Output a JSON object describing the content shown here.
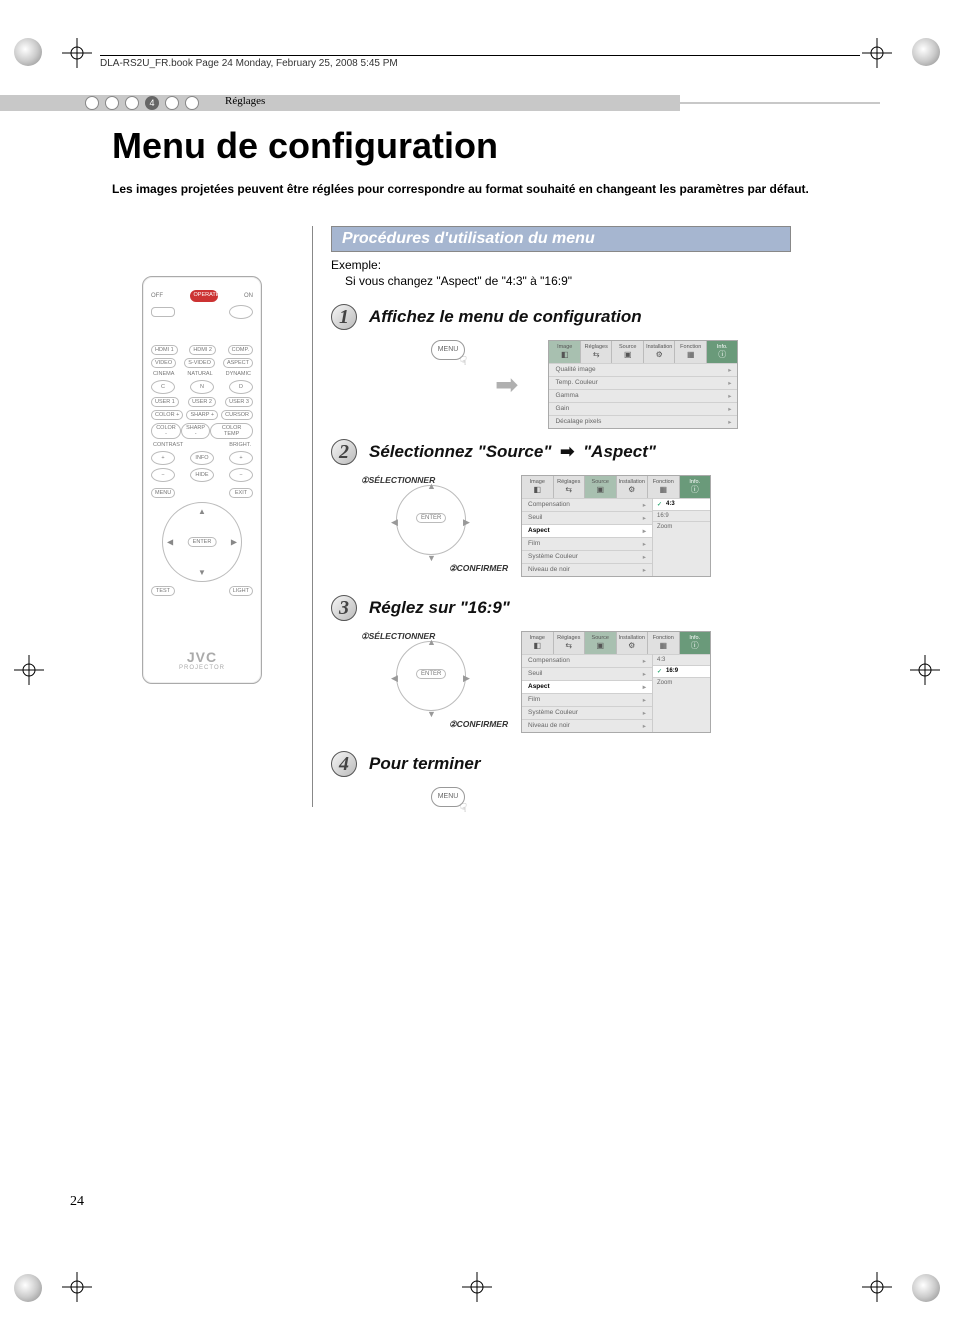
{
  "header_line": "DLA-RS2U_FR.book  Page 24  Monday, February 25, 2008  5:45 PM",
  "ribbon_step_num": "4",
  "ribbon_label": "Réglages",
  "title": "Menu de configuration",
  "intro": "Les images projetées peuvent être réglées pour correspondre au format souhaité en changeant les paramètres par défaut.",
  "section_header": "Procédures d'utilisation du menu",
  "example_heading": "Exemple:",
  "example_text": "Si vous changez \"Aspect\" de \"4:3\" à \"16:9\"",
  "steps": {
    "s1": {
      "num": "1",
      "title": "Affichez le menu de configuration"
    },
    "s2": {
      "num": "2",
      "title_pre": "Sélectionnez \"Source\"",
      "title_post": "\"Aspect\""
    },
    "s3": {
      "num": "3",
      "title": "Réglez sur \"16:9\""
    },
    "s4": {
      "num": "4",
      "title": "Pour terminer"
    }
  },
  "annot": {
    "select_num": "①",
    "select": "SÉLECTIONNER",
    "confirm_num": "②",
    "confirm": "CONFIRMER"
  },
  "btn": {
    "menu": "MENU",
    "enter": "ENTER"
  },
  "osd_tabs": [
    "Image",
    "Réglages",
    "Source",
    "Installation",
    "Fonction",
    "Info."
  ],
  "osd_tab_icons": [
    "◧",
    "⇆",
    "▣",
    "⚙",
    "▦",
    "ⓘ"
  ],
  "osd1_items": [
    "Qualité image",
    "Temp. Couleur",
    "Gamma",
    "Gain",
    "Décalage pixels"
  ],
  "osd2_left": [
    "Compensation",
    "Seuil",
    "Aspect",
    "Film",
    "Système Couleur",
    "Niveau de noir"
  ],
  "osd2_right": [
    "4:3",
    "16:9",
    "Zoom"
  ],
  "osd2_right_sel": 0,
  "osd3_right_sel": 1,
  "remote": {
    "off": "OFF",
    "operate": "OPERATE",
    "on": "ON",
    "row1": [
      "HDMI 1",
      "HDMI 2",
      "COMP."
    ],
    "row2": [
      "VIDEO",
      "S-VIDEO",
      "ASPECT"
    ],
    "row3_lbls": [
      "CINEMA",
      "NATURAL",
      "DYNAMIC"
    ],
    "row3": [
      "C",
      "N",
      "D"
    ],
    "row4": [
      "USER 1",
      "USER 2",
      "USER 3"
    ],
    "row5": [
      "COLOR +",
      "SHARP +",
      "CURSOR"
    ],
    "row6": [
      "COLOR -",
      "SHARP -",
      "COLOR TEMP"
    ],
    "contrast": "CONTRAST",
    "bright": "BRIGHT.",
    "info": "INFO",
    "hide": "HIDE",
    "menu": "MENU",
    "exit": "EXIT",
    "enter": "ENTER",
    "test": "TEST",
    "light": "LIGHT",
    "brand": "JVC",
    "projector": "PROJECTOR"
  },
  "page_number": "24"
}
